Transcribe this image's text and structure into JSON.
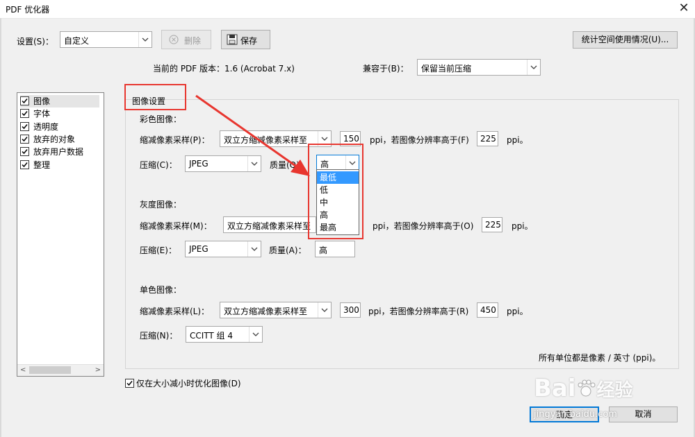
{
  "window": {
    "title": "PDF 优化器",
    "close_glyph": "✕"
  },
  "settings": {
    "label": "设置(S)：",
    "value": "自定义",
    "delete_label": "删除",
    "save_label": "保存",
    "stats_label": "统计空间使用情况(U)..."
  },
  "version": {
    "text": "当前的 PDF 版本：1.6 (Acrobat 7.x)",
    "compat_label": "兼容于(B)：",
    "compat_value": "保留当前压缩"
  },
  "categories": [
    {
      "label": "图像",
      "checked": true,
      "selected": true
    },
    {
      "label": "字体",
      "checked": true
    },
    {
      "label": "透明度",
      "checked": true
    },
    {
      "label": "放弃的对象",
      "checked": true
    },
    {
      "label": "放弃用户数据",
      "checked": true
    },
    {
      "label": "整理",
      "checked": true
    }
  ],
  "panel": {
    "title": "图像设置",
    "color": {
      "heading": "彩色图像：",
      "downsample_label": "缩减像素采样(P)：",
      "downsample_value": "双立方缩减像素采样至",
      "ppi_value": "150",
      "above_label": "ppi，若图像分辨率高于(F)",
      "above_value": "225",
      "ppi_unit": "ppi。",
      "compress_label": "压缩(C)：",
      "compress_value": "JPEG",
      "quality_label": "质量(Q)：",
      "quality_value": "高"
    },
    "gray": {
      "heading": "灰度图像：",
      "downsample_label": "缩减像素采样(M)：",
      "downsample_value": "双立方缩减像素采样至",
      "above_label": "ppi，若图像分辨率高于(O)",
      "above_value": "225",
      "ppi_unit": "ppi。",
      "compress_label": "压缩(E)：",
      "compress_value": "JPEG",
      "quality_label": "质量(A)：",
      "quality_value": "高"
    },
    "mono": {
      "heading": "单色图像：",
      "downsample_label": "缩减像素采样(L)：",
      "downsample_value": "双立方缩减像素采样至",
      "ppi_value": "300",
      "above_label": "ppi，若图像分辨率高于(R)",
      "above_value": "450",
      "ppi_unit": "ppi。",
      "compress_label": "压缩(N)：",
      "compress_value": "CCITT 组 4"
    },
    "units_note": "所有单位都是像素 / 英寸 (ppi)。"
  },
  "quality_options": [
    "最低",
    "低",
    "中",
    "高",
    "最高"
  ],
  "quality_selected_index": 0,
  "optimize_only_smaller": {
    "label": "仅在大小减小时优化图像(D)",
    "checked": true
  },
  "footer": {
    "ok_label": "确定",
    "cancel_label": "取消"
  },
  "watermark": {
    "brand": "Bai",
    "brand2": "经验",
    "url": "jingyan.baidu.com"
  },
  "colors": {
    "annotation_red": "#e8362f",
    "selection_blue": "#3399ff",
    "focus_blue": "#0078d7"
  }
}
